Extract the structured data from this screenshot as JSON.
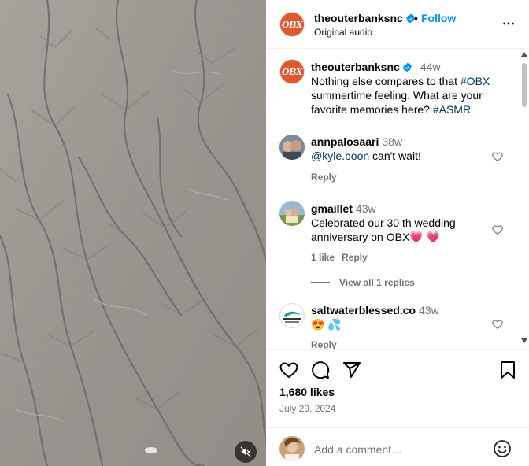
{
  "post": {
    "account": "theouterbanksnc",
    "follow_label": "Follow",
    "separator": "•",
    "audio": "Original audio",
    "avatar_text": "OBX"
  },
  "caption": {
    "user": "theouterbanksnc",
    "time": "44w",
    "text_1": "Nothing else compares to that ",
    "tag_1": "#OBX",
    "text_2": " summertime feeling. What are your favorite memories here? ",
    "tag_2": "#ASMR"
  },
  "comments": [
    {
      "user": "annpalosaari",
      "time": "38w",
      "mention": "@kyle.boon",
      "text": " can't wait!",
      "reply_label": "Reply"
    },
    {
      "user": "gmaillet",
      "time": "43w",
      "text": "Celebrated our 30 th wedding anniversary on OBX",
      "emoji": "💗 💗",
      "likes_label": "1 like",
      "reply_label": "Reply",
      "view_replies": "View all 1 replies"
    },
    {
      "user": "saltwaterblessed.co",
      "time": "43w",
      "emoji": "😍 💦",
      "reply_label": "Reply"
    }
  ],
  "stats": {
    "likes": "1,680 likes",
    "date": "July 29, 2024"
  },
  "composer": {
    "placeholder": "Add a comment…"
  },
  "icons": {
    "more": "more-horizontal-icon",
    "like": "heart-icon",
    "comment": "comment-icon",
    "share": "share-icon",
    "save": "bookmark-icon",
    "emoji": "emoji-icon",
    "mute": "speaker-muted-icon",
    "verified": "verified-badge-icon"
  },
  "colors": {
    "link": "#0095f6",
    "tag": "#00376b",
    "muted": "#737373",
    "brand": "#e4572e"
  }
}
